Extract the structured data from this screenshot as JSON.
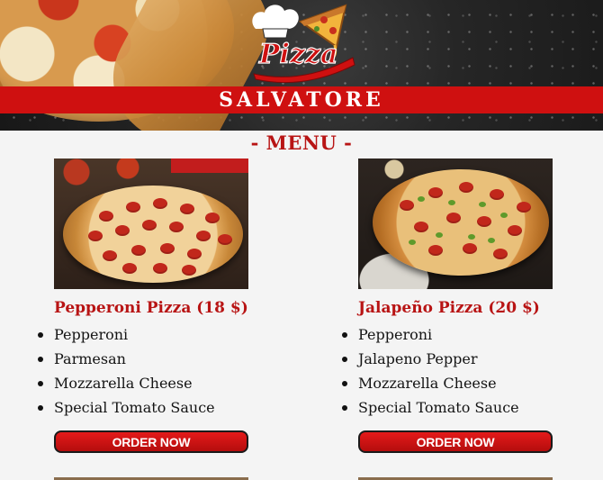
{
  "header": {
    "logo_text": "Pizza",
    "brand_name": "SALVATORE"
  },
  "menu": {
    "title": "- MENU -",
    "items": [
      {
        "title": "Pepperoni Pizza (18 $)",
        "ingredients": [
          "Pepperoni",
          "Parmesan",
          "Mozzarella Cheese",
          "Special Tomato Sauce"
        ],
        "button_label": "ORDER NOW"
      },
      {
        "title": "Jalapeño Pizza (20 $)",
        "ingredients": [
          "Pepperoni",
          "Jalapeno Pepper",
          "Mozzarella Cheese",
          "Special Tomato Sauce"
        ],
        "button_label": "ORDER NOW"
      }
    ]
  },
  "colors": {
    "accent": "#cf1010",
    "title_red": "#b81414",
    "page_bg": "#f4f4f4"
  },
  "icons": [
    "chef-hat-icon",
    "pizza-slice-icon"
  ]
}
